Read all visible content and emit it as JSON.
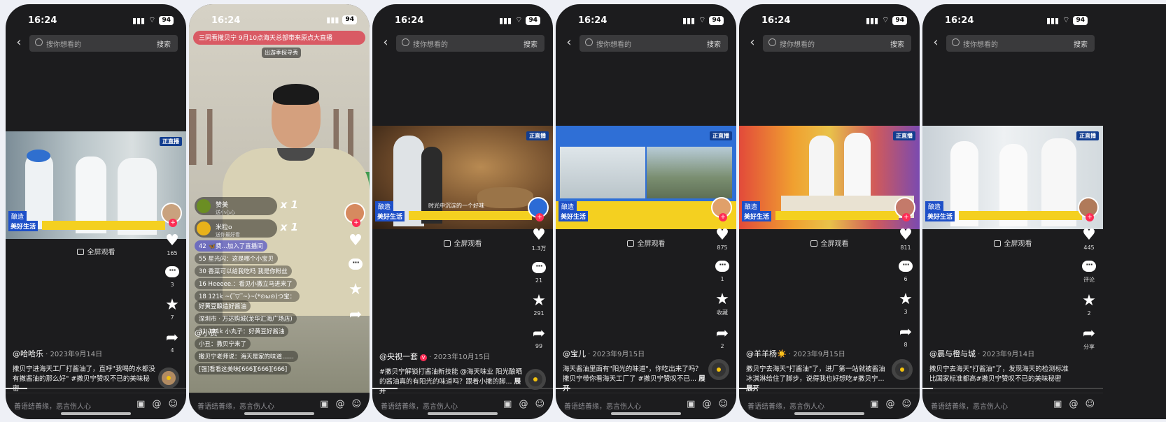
{
  "status": {
    "time": "16:24",
    "battery": "94"
  },
  "search": {
    "placeholder": "搜你想看的",
    "button": "搜索"
  },
  "fullscreen": "全屏观看",
  "comment_placeholder": "善语结善缘，恶言伤人心",
  "expand": "展开",
  "phones": [
    {
      "caption_tag": "酿造",
      "caption_brand": "美好生活",
      "likes": "165",
      "comments": "3",
      "favorites": "7",
      "shares": "4",
      "author": "@哈哈乐",
      "date": " · 2023年9月14日",
      "desc": "撒贝宁进海天工厂打酱油了，直呼\"我喝的水都没有撒酱油的那么好\" #撒贝宁赞叹不已的美味秘密"
    },
    {
      "live": true,
      "banner": "三同看撒贝宁  9月10点海天总部带来原点大直播",
      "promo": "出游季探寻秀",
      "gifts": [
        {
          "name": "赞美",
          "sub": "送小心心",
          "count": "x 1"
        },
        {
          "name": "米粒o",
          "sub": "送你最好看",
          "count": "x 1"
        }
      ],
      "lines": [
        "42 🦋费...加入了直播间",
        "55 星光闪：这是哪个小宝贝",
        "30 香菜可以给我吃吗 我是你粉丝",
        "16 Heeeee.：看见小撒立马进来了",
        "18 121k ~(‾▽‾~)~(*⊙ω⊙)つ宝：",
        "好黄豆酿造好酱油",
        "深圳市 · 万达购城(龙华汇海广场店)",
        "31 121k 小丸子：好黄豆好酱油",
        "小丑：撒贝宁来了",
        "撒贝宁老师说：海天是家的味道……",
        "[强]看看这美味[666][666][666]"
      ],
      "author": "@小贾"
    },
    {
      "caption_tag": "酿造",
      "caption_brand": "美好生活",
      "subtitle": "时光中沉淀的一个好味",
      "likes": "1.3万",
      "comments": "21",
      "favorites": "291",
      "shares": "99",
      "author": "@央视一套",
      "date": " · 2023年10月15日",
      "desc": "#撒贝宁解锁打酱油新技能 @海天味业 阳光酿晒的酱油真的有阳光的味道吗？跟着小撒的脚... "
    },
    {
      "caption_tag": "酿造",
      "caption_brand": "美好生活",
      "likes": "875",
      "comments": "1",
      "favorites": "收藏",
      "shares": "2",
      "author": "@宝儿",
      "date": " · 2023年9月15日",
      "desc": "海天酱油里面有\"阳光的味道\"，你吃出来了吗？撒贝宁带你看海天工厂了 #撒贝宁赞叹不已... "
    },
    {
      "caption_tag": "酿造",
      "caption_brand": "美好生活",
      "likes": "811",
      "comments": "6",
      "favorites": "3",
      "shares": "8",
      "author": "@羊羊杨☀️",
      "date": " · 2023年9月15日",
      "desc": "撒贝宁去海天\"打酱油\"了，进厂第一站就被酱油冰淇淋给住了脚步，说得我也好想吃#撒贝宁... "
    },
    {
      "caption_tag": "酿造",
      "caption_brand": "美好生活",
      "likes": "445",
      "comments": "评论",
      "favorites": "2",
      "shares": "分享",
      "author": "@晨与橙与城",
      "date": " · 2023年9月14日",
      "desc": "撒贝宁去海天\"打酱油\"了，发现海天的检测标准比国家标准都高#撒贝宁赞叹不已的美味秘密"
    }
  ],
  "logo_text": "正直播",
  "colors": {
    "bg": "#1c1c1e",
    "accent": "#fe2c55",
    "caption_bar": "#f4d020"
  }
}
